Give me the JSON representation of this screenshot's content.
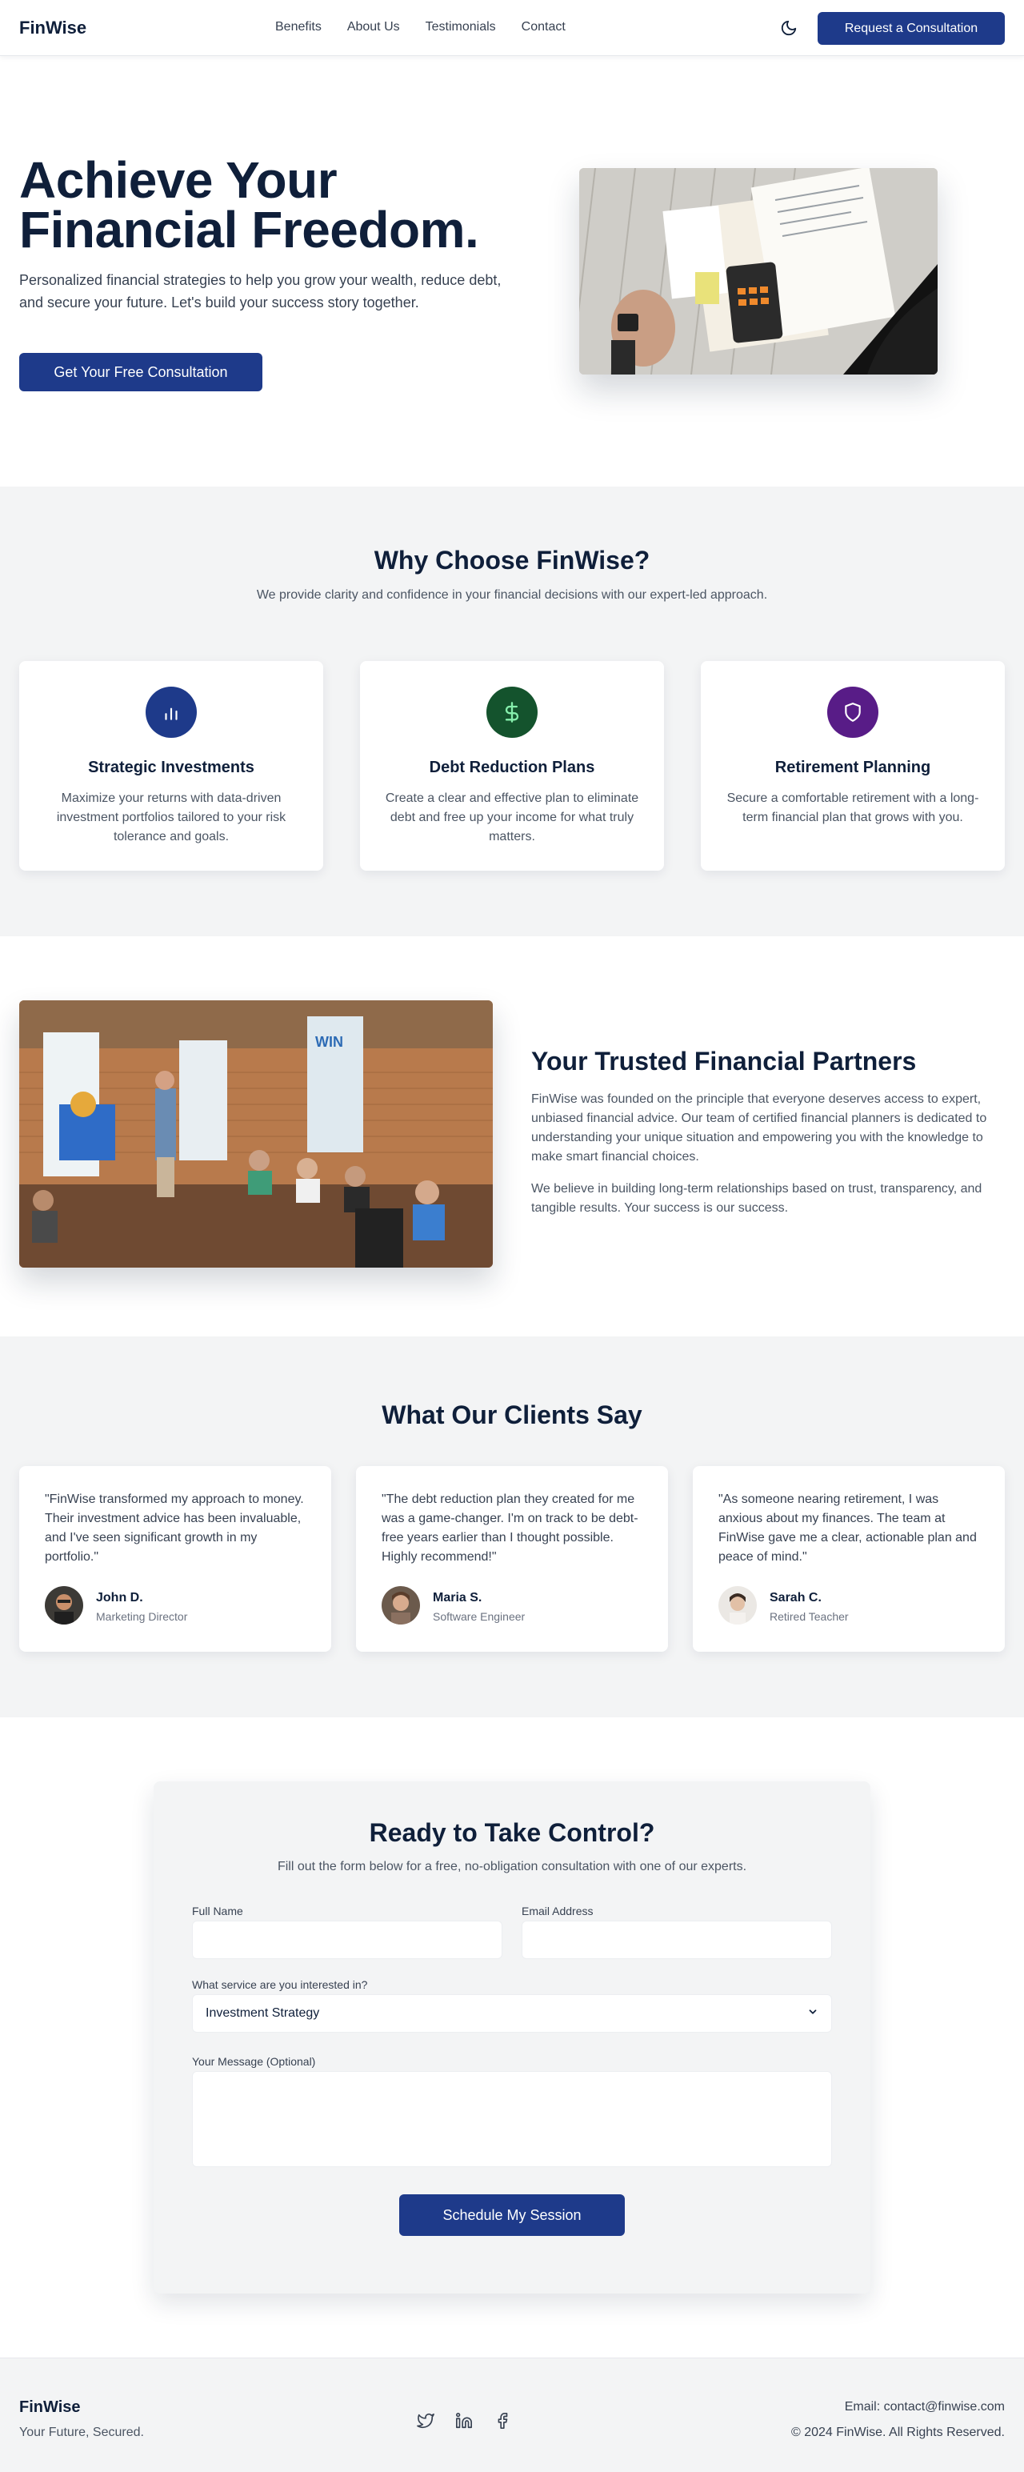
{
  "header": {
    "logo": "FinWise",
    "nav": [
      "Benefits",
      "About Us",
      "Testimonials",
      "Contact"
    ],
    "cta": "Request a Consultation",
    "theme_icon": "moon-icon"
  },
  "hero": {
    "title_line1": "Achieve Your",
    "title_line2": "Financial Freedom.",
    "description": "Personalized financial strategies to help you grow your wealth, reduce debt, and secure your future. Let's build your success story together.",
    "button": "Get Your Free Consultation"
  },
  "why": {
    "title": "Why Choose FinWise?",
    "subtitle": "We provide clarity and confidence in your financial decisions with our expert-led approach.",
    "cards": [
      {
        "icon": "bar-chart-icon",
        "color": "#1e3a8a",
        "title": "Strategic Investments",
        "desc": "Maximize your returns with data-driven investment portfolios tailored to your risk tolerance and goals."
      },
      {
        "icon": "dollar-icon",
        "color": "#14532d",
        "title": "Debt Reduction Plans",
        "desc": "Create a clear and effective plan to eliminate debt and free up your income for what truly matters."
      },
      {
        "icon": "shield-icon",
        "color": "#581c87",
        "title": "Retirement Planning",
        "desc": "Secure a comfortable retirement with a long-term financial plan that grows with you."
      }
    ]
  },
  "about": {
    "title": "Your Trusted Financial Partners",
    "p1": "FinWise was founded on the principle that everyone deserves access to expert, unbiased financial advice. Our team of certified financial planners is dedicated to understanding your unique situation and empowering you with the knowledge to make smart financial choices.",
    "p2": "We believe in building long-term relationships based on trust, transparency, and tangible results. Your success is our success.",
    "image_sign": "WIN"
  },
  "testimonials": {
    "title": "What Our Clients Say",
    "items": [
      {
        "quote": "\"FinWise transformed my approach to money. Their investment advice has been invaluable, and I've seen significant growth in my portfolio.\"",
        "name": "John D.",
        "role": "Marketing Director"
      },
      {
        "quote": "\"The debt reduction plan they created for me was a game-changer. I'm on track to be debt-free years earlier than I thought possible. Highly recommend!\"",
        "name": "Maria S.",
        "role": "Software Engineer"
      },
      {
        "quote": "\"As someone nearing retirement, I was anxious about my finances. The team at FinWise gave me a clear, actionable plan and peace of mind.\"",
        "name": "Sarah C.",
        "role": "Retired Teacher"
      }
    ]
  },
  "contact": {
    "title": "Ready to Take Control?",
    "subtitle": "Fill out the form below for a free, no-obligation consultation with one of our experts.",
    "name_label": "Full Name",
    "name_value": "",
    "email_label": "Email Address",
    "email_value": "",
    "service_label": "What service are you interested in?",
    "service_value": "Investment Strategy",
    "message_label": "Your Message (Optional)",
    "submit": "Schedule My Session"
  },
  "footer": {
    "logo": "FinWise",
    "tagline": "Your Future, Secured.",
    "social": [
      "twitter-icon",
      "linkedin-icon",
      "facebook-icon"
    ],
    "email": "Email: contact@finwise.com",
    "copyright": "© 2024 FinWise. All Rights Reserved."
  }
}
